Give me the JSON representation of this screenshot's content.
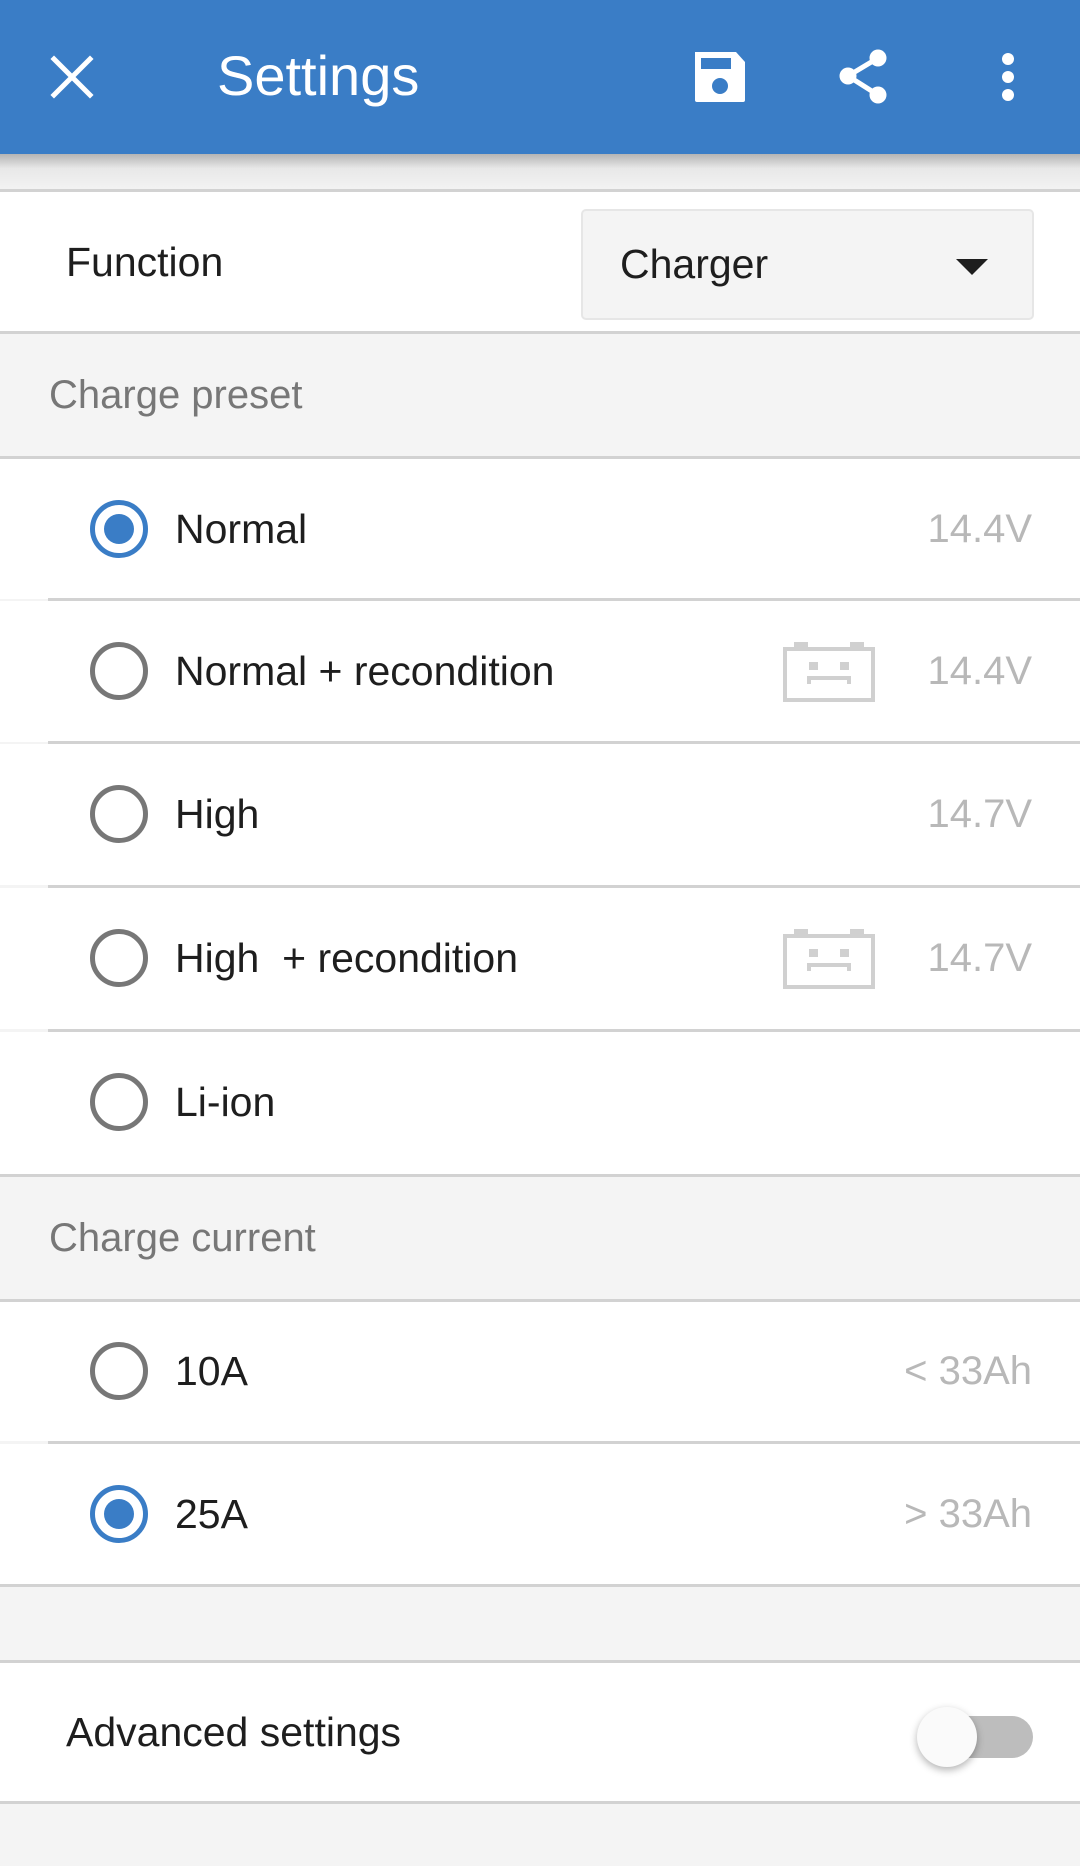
{
  "appbar": {
    "title": "Settings",
    "close_icon": "close-icon",
    "save_icon": "save-icon",
    "share_icon": "share-icon",
    "more_icon": "more-vert-icon",
    "color": "#3a7dc6"
  },
  "function": {
    "label": "Function",
    "selected": "Charger"
  },
  "charge_preset": {
    "header": "Charge preset",
    "options": [
      {
        "label": "Normal",
        "value": "14.4V",
        "selected": true,
        "recondition_icon": false
      },
      {
        "label": "Normal + recondition",
        "value": "14.4V",
        "selected": false,
        "recondition_icon": true
      },
      {
        "label": "High",
        "value": "14.7V",
        "selected": false,
        "recondition_icon": false
      },
      {
        "label": "High  + recondition",
        "value": "14.7V",
        "selected": false,
        "recondition_icon": true
      },
      {
        "label": "Li-ion",
        "value": "",
        "selected": false,
        "recondition_icon": false
      }
    ]
  },
  "charge_current": {
    "header": "Charge current",
    "options": [
      {
        "label": "10A",
        "value": "< 33Ah",
        "selected": false
      },
      {
        "label": "25A",
        "value": "> 33Ah",
        "selected": true
      }
    ]
  },
  "advanced": {
    "label": "Advanced settings",
    "enabled": false
  }
}
